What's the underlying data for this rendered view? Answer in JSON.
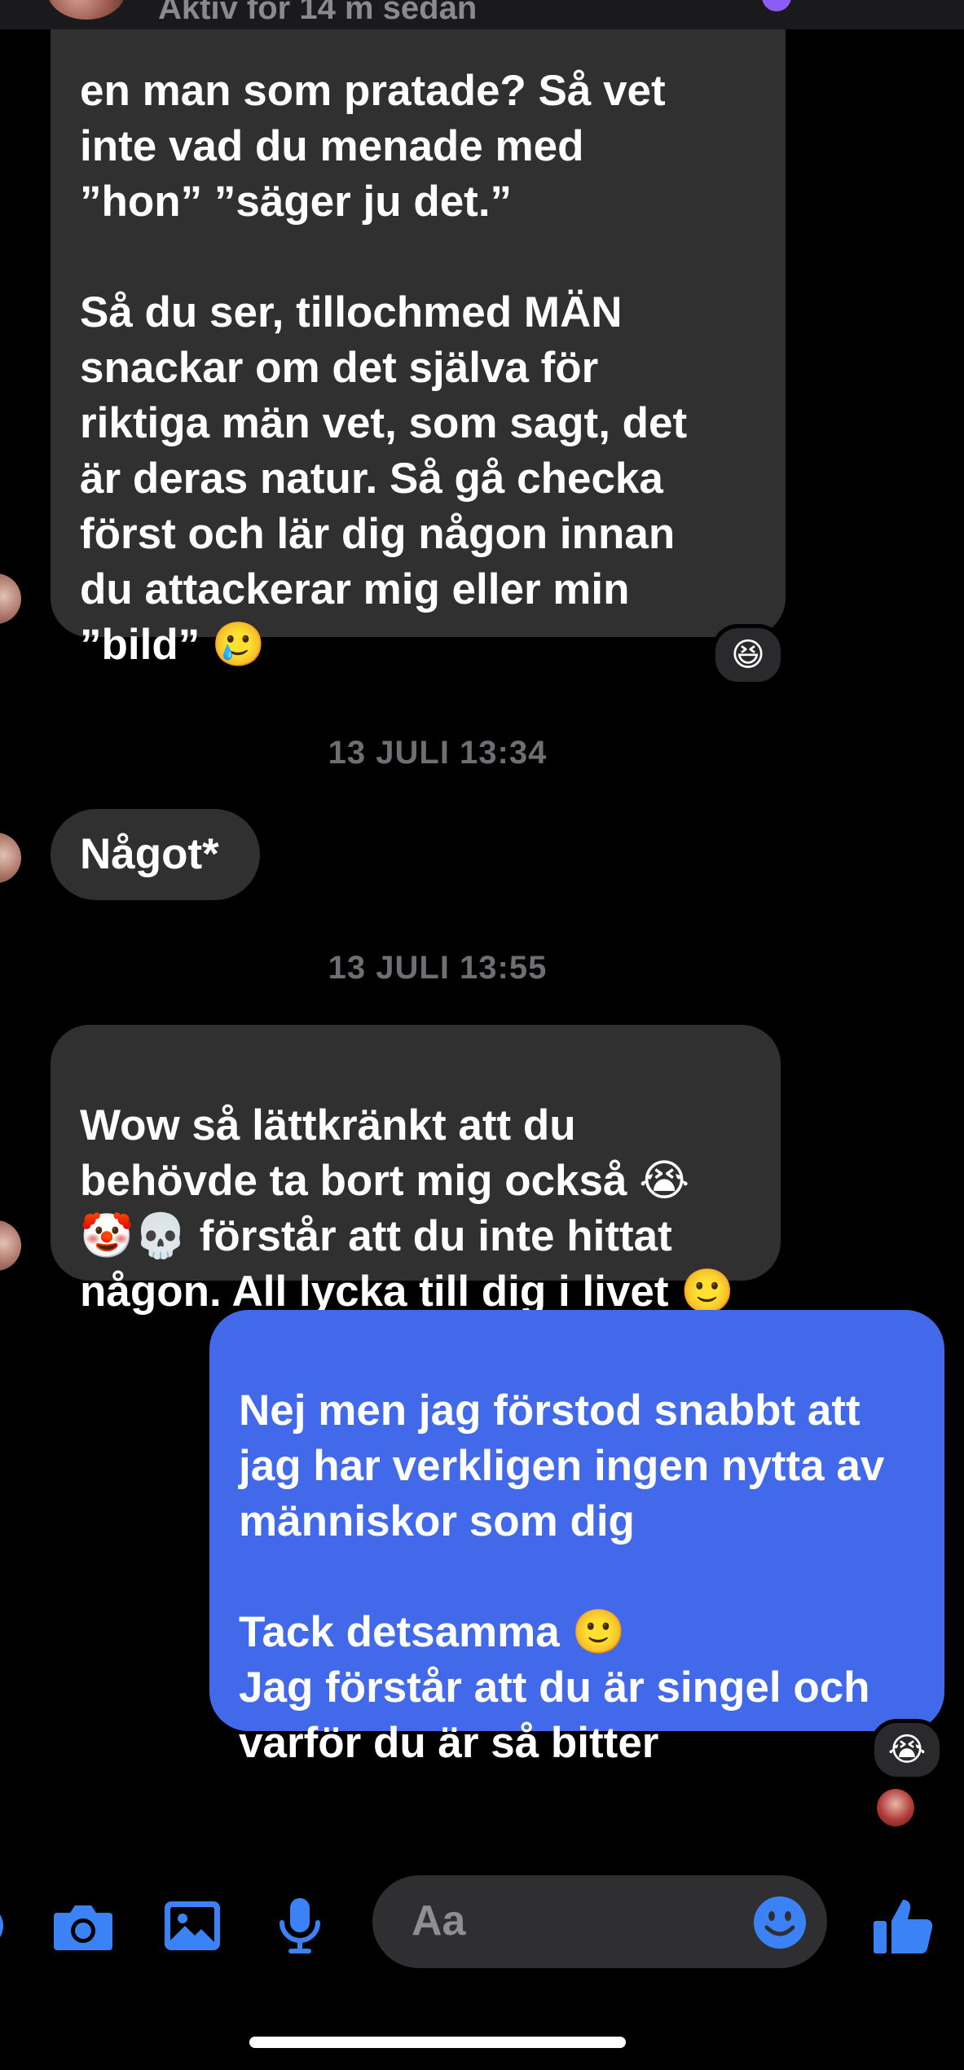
{
  "header": {
    "status": "Aktiv för 14 m sedan"
  },
  "messages": [
    {
      "id": "msg1",
      "direction": "incoming",
      "text_lines": [
        "en man som pratade? Så vet",
        "inte vad du menade med",
        "”hon” ”säger ju det.”",
        "",
        "Så du ser, tillochmed MÄN",
        "snackar om det själva för",
        "riktiga män vet, som sagt, det",
        "är deras natur. Så gå checka",
        "först och lär dig någon innan",
        "du attackerar mig eller min",
        "”bild” 🥲"
      ],
      "reaction": "😆"
    },
    {
      "id": "msg2",
      "direction": "incoming",
      "text": "Något*"
    },
    {
      "id": "msg3",
      "direction": "incoming",
      "text_lines": [
        "Wow så lättkränkt att du",
        "behövde ta bort mig också 😭",
        "🤡💀 förstår att du inte hittat",
        "någon. All lycka till dig i livet 🙂"
      ]
    },
    {
      "id": "msg4",
      "direction": "outgoing",
      "text_lines": [
        "Nej men jag förstod snabbt att",
        "jag har verkligen ingen nytta av",
        "människor som dig",
        "",
        "Tack detsamma 🙂",
        "Jag förstår att du är singel och",
        "varför du är så bitter"
      ],
      "reaction": "😭"
    }
  ],
  "timestamps": {
    "first": "13 JULI 13:34",
    "second": "13 JULI 13:55"
  },
  "composer": {
    "placeholder": "Aa",
    "icons": [
      "camera-icon",
      "gallery-icon",
      "microphone-icon",
      "emoji-icon",
      "thumbs-up-icon"
    ]
  },
  "colors": {
    "background": "#000000",
    "incoming_bubble": "#303030",
    "outgoing_bubble": "#4169e9",
    "accent": "#3b82f6",
    "timestamp": "#6e6e73"
  }
}
